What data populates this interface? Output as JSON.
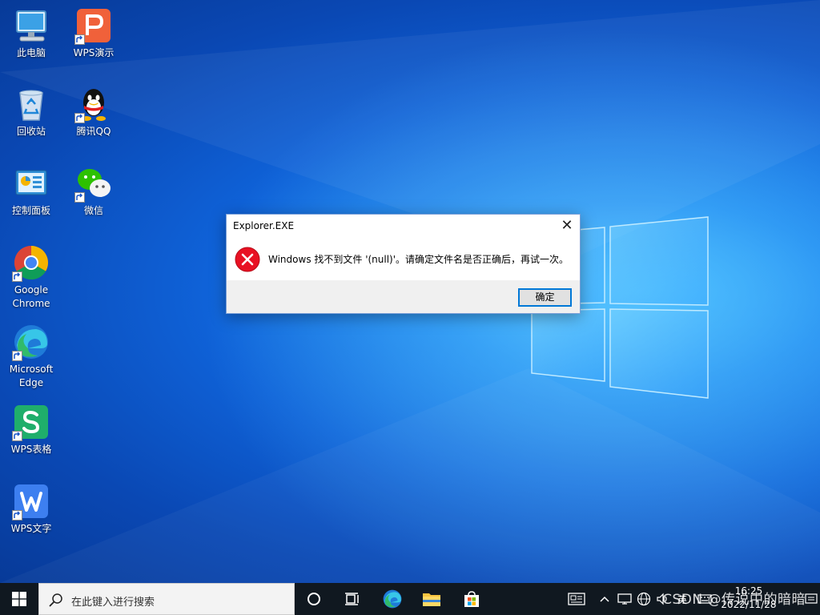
{
  "desktop": {
    "icons": [
      {
        "label": "此电脑",
        "icon": "computer-icon"
      },
      {
        "label": "WPS演示",
        "icon": "wps-presentation-icon"
      },
      {
        "label": "回收站",
        "icon": "recycle-bin-icon"
      },
      {
        "label": "腾讯QQ",
        "icon": "qq-icon"
      },
      {
        "label": "控制面板",
        "icon": "control-panel-icon"
      },
      {
        "label": "微信",
        "icon": "wechat-icon"
      },
      {
        "label_line1": "Google",
        "label_line2": "Chrome",
        "icon": "chrome-icon"
      },
      {
        "label_line1": "Microsoft",
        "label_line2": "Edge",
        "icon": "edge-icon"
      },
      {
        "label": "WPS表格",
        "icon": "wps-spreadsheet-icon"
      },
      {
        "label": "WPS文字",
        "icon": "wps-writer-icon"
      }
    ]
  },
  "dialog": {
    "title": "Explorer.EXE",
    "close_glyph": "✕",
    "message": "Windows 找不到文件 '(null)'。请确定文件名是否正确后，再试一次。",
    "ok_label": "确定",
    "icon": "error-icon"
  },
  "taskbar": {
    "search_placeholder": "在此键入进行搜索",
    "time": "16:25",
    "date": "2022/11/28",
    "ime_label": "英",
    "watermark": "CSDN @传说中的暗暗",
    "colors": {
      "background": "#101820",
      "accent": "#0078d7"
    }
  }
}
